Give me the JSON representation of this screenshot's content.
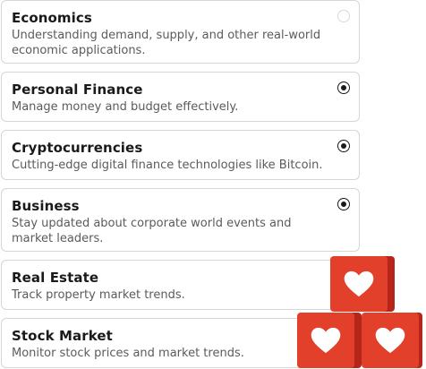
{
  "options": [
    {
      "title": "Economics",
      "description": "Understanding demand, supply, and other real-world economic applications.",
      "selected": false
    },
    {
      "title": "Personal Finance",
      "description": "Manage money and budget effectively.",
      "selected": true
    },
    {
      "title": "Cryptocurrencies",
      "description": "Cutting-edge digital finance technologies like Bitcoin.",
      "selected": true
    },
    {
      "title": "Business",
      "description": "Stay updated about corporate world events and market leaders.",
      "selected": true
    },
    {
      "title": "Real Estate",
      "description": "Track property market trends.",
      "selected": false
    },
    {
      "title": "Stock Market",
      "description": "Monitor stock prices and market trends.",
      "selected": false
    }
  ],
  "decorations": {
    "heart_badges": [
      {
        "icon": "heart-icon",
        "color": "#e2402b",
        "shadow_color": "#b5251a"
      },
      {
        "icon": "heart-icon",
        "color": "#e2402b",
        "shadow_color": "#b5251a"
      },
      {
        "icon": "heart-icon",
        "color": "#e2402b",
        "shadow_color": "#b5251a"
      }
    ]
  }
}
